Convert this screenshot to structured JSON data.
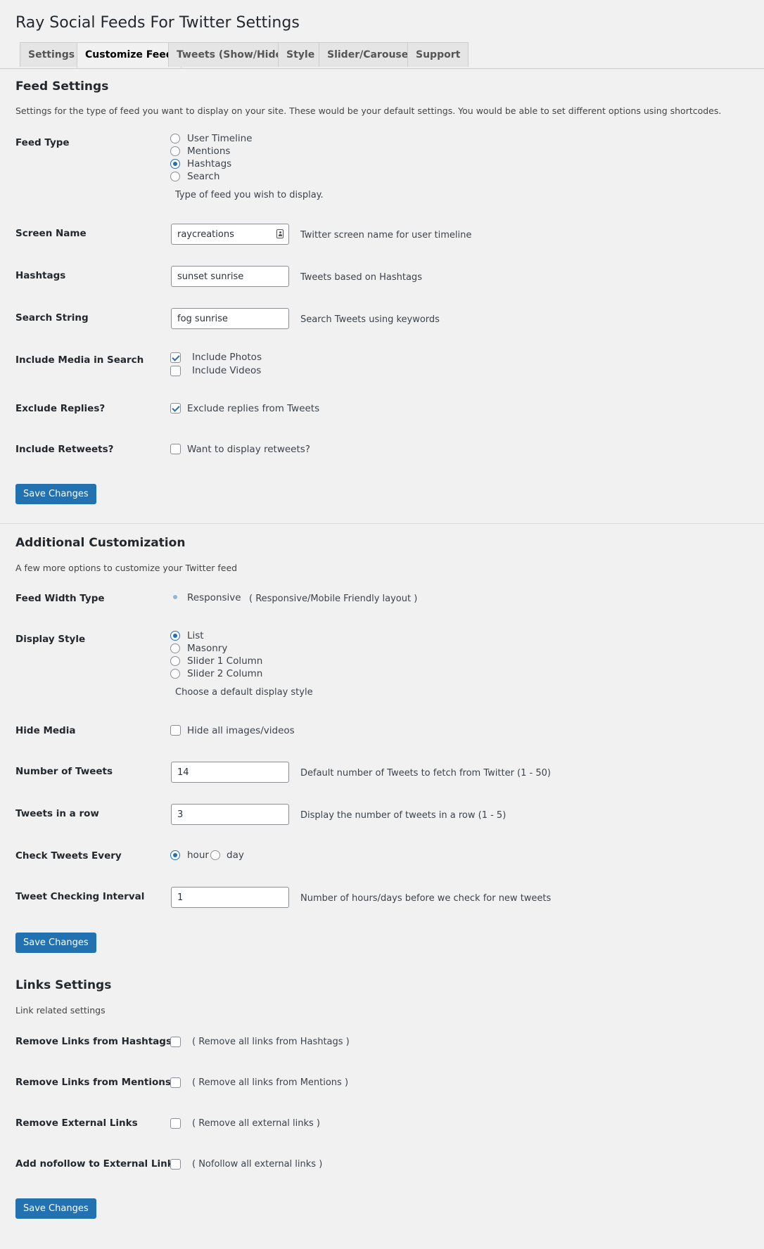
{
  "page_title": "Ray Social Feeds For Twitter Settings",
  "tabs": [
    {
      "label": "Settings"
    },
    {
      "label": "Customize Feed"
    },
    {
      "label": "Tweets (Show/Hide)"
    },
    {
      "label": "Style"
    },
    {
      "label": "Slider/Carousel"
    },
    {
      "label": "Support"
    }
  ],
  "feed_settings": {
    "title": "Feed Settings",
    "description": "Settings for the type of feed you want to display on your site. These would be your default settings. You would be able to set different options using shortcodes.",
    "feed_type": {
      "label": "Feed Type",
      "options": [
        "User Timeline",
        "Mentions",
        "Hashtags",
        "Search"
      ],
      "selected": "Hashtags",
      "help": "Type of feed you wish to display."
    },
    "screen_name": {
      "label": "Screen Name",
      "value": "raycreations",
      "help": "Twitter screen name for user timeline"
    },
    "hashtags": {
      "label": "Hashtags",
      "value": "sunset sunrise",
      "help": "Tweets based on Hashtags"
    },
    "search_string": {
      "label": "Search String",
      "value": "fog sunrise",
      "help": "Search Tweets using keywords"
    },
    "include_media": {
      "label": "Include Media in Search",
      "photos": {
        "label": "Include Photos",
        "checked": true
      },
      "videos": {
        "label": "Include Videos",
        "checked": false
      }
    },
    "exclude_replies": {
      "label": "Exclude Replies?",
      "option": "Exclude replies from Tweets",
      "checked": true
    },
    "include_retweets": {
      "label": "Include Retweets?",
      "option": "Want to display retweets?",
      "checked": false
    },
    "save_label": "Save Changes"
  },
  "additional": {
    "title": "Additional Customization",
    "description": "A few more options to customize your Twitter feed",
    "feed_width": {
      "label": "Feed Width Type",
      "option": "Responsive",
      "help": "( Responsive/Mobile Friendly layout )"
    },
    "display_style": {
      "label": "Display Style",
      "options": [
        "List",
        "Masonry",
        "Slider 1 Column",
        "Slider 2 Column"
      ],
      "selected": "List",
      "help": "Choose a default display style"
    },
    "hide_media": {
      "label": "Hide Media",
      "option": "Hide all images/videos",
      "checked": false
    },
    "number_of_tweets": {
      "label": "Number of Tweets",
      "value": "14",
      "help": "Default number of Tweets to fetch from Twitter (1 - 50)"
    },
    "tweets_in_row": {
      "label": "Tweets in a row",
      "value": "3",
      "help": "Display the number of tweets in a row (1 - 5)"
    },
    "check_tweets": {
      "label": "Check Tweets Every",
      "options": [
        "hour",
        "day"
      ],
      "selected": "hour"
    },
    "interval": {
      "label": "Tweet Checking Interval",
      "value": "1",
      "help": "Number of hours/days before we check for new tweets"
    },
    "save_label": "Save Changes"
  },
  "links": {
    "title": "Links Settings",
    "description": "Link related settings",
    "rows": [
      {
        "label": "Remove Links from Hashtags",
        "help": "( Remove all links from Hashtags )",
        "checked": false
      },
      {
        "label": "Remove Links from Mentions",
        "help": "( Remove all links from Mentions )",
        "checked": false
      },
      {
        "label": "Remove External Links",
        "help": "( Remove all external links )",
        "checked": false
      },
      {
        "label": "Add nofollow to External Links",
        "help": "( Nofollow all external links )",
        "checked": false
      }
    ],
    "save_label": "Save Changes"
  },
  "colors": {
    "accent": "#2271b1",
    "background": "#f1f1f1"
  },
  "icons": {
    "screen_name_field": "contact-card-icon"
  }
}
